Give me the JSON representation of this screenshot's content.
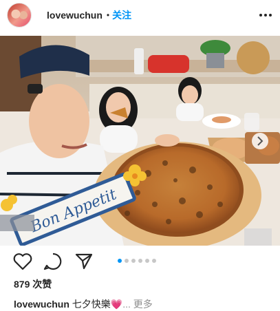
{
  "post": {
    "username": "lovewuchun",
    "separator": "•",
    "follow_label": "关注",
    "overlay_text": "Bon Appetit",
    "likes_text": "879 次赞",
    "caption_username": "lovewuchun",
    "caption_text": "七夕快樂",
    "caption_more": "... 更多",
    "carousel_count": 6,
    "carousel_active": 0
  },
  "icons": {
    "more": "more-options-icon",
    "like": "heart-icon",
    "comment": "comment-icon",
    "share": "share-icon",
    "next": "chevron-right-icon",
    "emoji": "pink-heart-emoji"
  },
  "colors": {
    "follow": "#0095f6",
    "carousel_active": "#0095f6",
    "carousel_inactive": "#c7c7c7",
    "heart_emoji": "#e8579a"
  }
}
